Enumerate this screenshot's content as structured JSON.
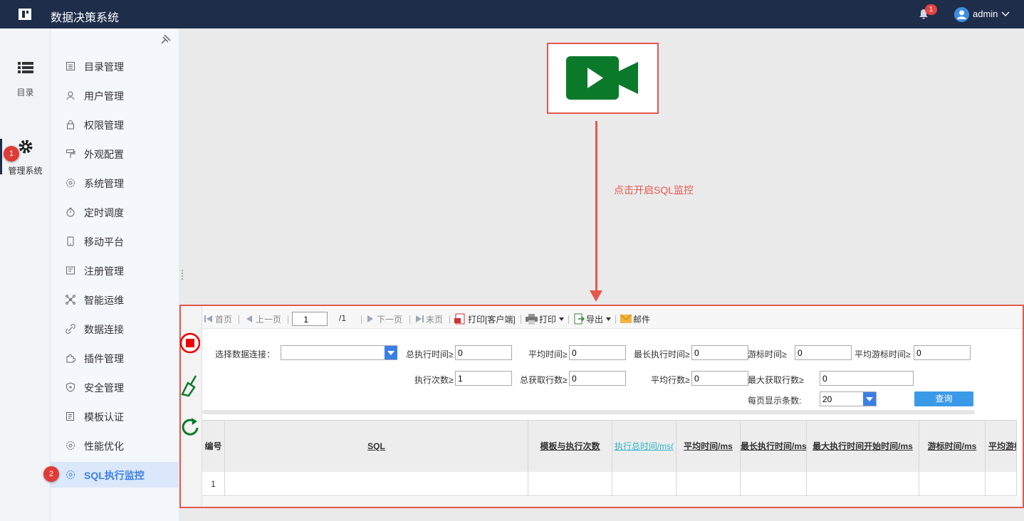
{
  "app": {
    "title": "数据决策系统",
    "notification_count": "1",
    "user": "admin"
  },
  "rail": {
    "items": [
      {
        "label": "目录",
        "icon": "list-icon"
      },
      {
        "label": "管理系统",
        "icon": "gear-icon"
      }
    ]
  },
  "menu": {
    "items": [
      {
        "label": "目录管理",
        "icon": "catalog-icon"
      },
      {
        "label": "用户管理",
        "icon": "user-icon"
      },
      {
        "label": "权限管理",
        "icon": "lock-icon"
      },
      {
        "label": "外观配置",
        "icon": "paint-roller-icon"
      },
      {
        "label": "系统管理",
        "icon": "settings-icon"
      },
      {
        "label": "定时调度",
        "icon": "stopwatch-icon"
      },
      {
        "label": "移动平台",
        "icon": "mobile-icon"
      },
      {
        "label": "注册管理",
        "icon": "register-icon"
      },
      {
        "label": "智能运维",
        "icon": "network-icon"
      },
      {
        "label": "数据连接",
        "icon": "link-icon"
      },
      {
        "label": "插件管理",
        "icon": "puzzle-icon"
      },
      {
        "label": "安全管理",
        "icon": "shield-icon"
      },
      {
        "label": "模板认证",
        "icon": "template-icon"
      },
      {
        "label": "性能优化",
        "icon": "performance-icon"
      },
      {
        "label": "SQL执行监控",
        "icon": "settings-icon"
      }
    ],
    "active_index": 14
  },
  "callouts": {
    "one": "1",
    "two": "2",
    "annotation": "点击开启SQL监控"
  },
  "toolbar": {
    "first": "首页",
    "prev": "上一页",
    "page_value": "1",
    "page_total": "/1",
    "next": "下一页",
    "last": "末页",
    "print_client": "打印[客户端]",
    "print": "打印",
    "export": "导出",
    "mail": "邮件"
  },
  "filters": {
    "conn_label": "选择数据连接：",
    "conn_value": "",
    "total_time_label": "总执行时间≥",
    "total_time": "0",
    "avg_time_label": "平均时间≥",
    "avg_time": "0",
    "max_time_label": "最长执行时间≥",
    "max_time": "0",
    "cursor_label": "游标时间≥",
    "cursor": "0",
    "avg_cursor_label": "平均游标时间≥",
    "avg_cursor": "0",
    "exec_count_label": "执行次数≥",
    "exec_count": "1",
    "total_rows_label": "总获取行数≥",
    "total_rows": "0",
    "avg_rows_label": "平均行数≥",
    "avg_rows": "0",
    "max_rows_label": "最大获取行数≥",
    "max_rows": "0",
    "page_size_label": "每页显示条数:",
    "page_size": "20",
    "query_label": "查询"
  },
  "table": {
    "columns": [
      "编号",
      "SQL",
      "模板与执行次数",
      "执行总时间/ms(",
      "平均时间/ms",
      "最长执行时间/ms",
      "最大执行时间开始时间/ms",
      "游标时间/ms",
      "平均游标"
    ],
    "rows": [
      [
        "1",
        "",
        "",
        "",
        "",
        "",
        "",
        "",
        ""
      ]
    ]
  },
  "colors": {
    "header_bg": "#1e2d4a",
    "accent": "#3b7fe6",
    "callout": "#e4574d",
    "sort_active": "#2bb5c9",
    "camera": "#0a7a2a"
  }
}
